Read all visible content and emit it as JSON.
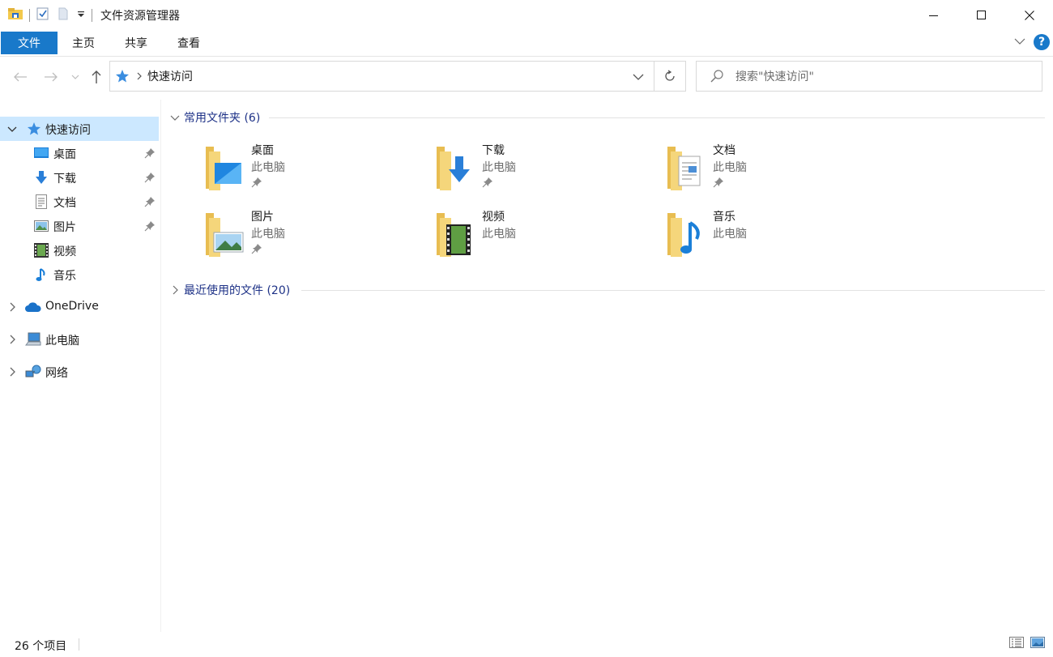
{
  "window": {
    "title": "文件资源管理器",
    "controls": [
      "minimize-icon",
      "maximize-icon",
      "close-icon"
    ]
  },
  "ribbon": {
    "tabs": [
      {
        "label": "文件",
        "active": true
      },
      {
        "label": "主页",
        "active": false
      },
      {
        "label": "共享",
        "active": false
      },
      {
        "label": "查看",
        "active": false
      }
    ],
    "help_label": "?"
  },
  "address": {
    "path": "快速访问",
    "search_placeholder": "搜索\"快速访问\""
  },
  "navpane": {
    "quick_access": "快速访问",
    "pinned": [
      {
        "label": "桌面",
        "icon": "desktop-icon",
        "pinned": true
      },
      {
        "label": "下载",
        "icon": "download-icon",
        "pinned": true
      },
      {
        "label": "文档",
        "icon": "document-icon",
        "pinned": true
      },
      {
        "label": "图片",
        "icon": "pictures-icon",
        "pinned": true
      },
      {
        "label": "视频",
        "icon": "videos-icon",
        "pinned": false
      },
      {
        "label": "音乐",
        "icon": "music-icon",
        "pinned": false
      }
    ],
    "roots": [
      {
        "label": "OneDrive",
        "icon": "onedrive-icon"
      },
      {
        "label": "此电脑",
        "icon": "this-pc-icon"
      },
      {
        "label": "网络",
        "icon": "network-icon"
      }
    ]
  },
  "content": {
    "frequent_header": "常用文件夹 (6)",
    "recent_header": "最近使用的文件 (20)",
    "folders": [
      {
        "name": "桌面",
        "location": "此电脑",
        "pinned": true,
        "icon": "desktop-folder-icon"
      },
      {
        "name": "下载",
        "location": "此电脑",
        "pinned": true,
        "icon": "download-folder-icon"
      },
      {
        "name": "文档",
        "location": "此电脑",
        "pinned": true,
        "icon": "documents-folder-icon"
      },
      {
        "name": "图片",
        "location": "此电脑",
        "pinned": true,
        "icon": "pictures-folder-icon"
      },
      {
        "name": "视频",
        "location": "此电脑",
        "pinned": false,
        "icon": "videos-folder-icon"
      },
      {
        "name": "音乐",
        "location": "此电脑",
        "pinned": false,
        "icon": "music-folder-icon"
      }
    ]
  },
  "status": {
    "item_count": "26 个项目"
  },
  "colors": {
    "accent": "#1979ca",
    "selection": "#cce8ff",
    "group_header": "#1e3287",
    "folder": "#f5d67b"
  }
}
